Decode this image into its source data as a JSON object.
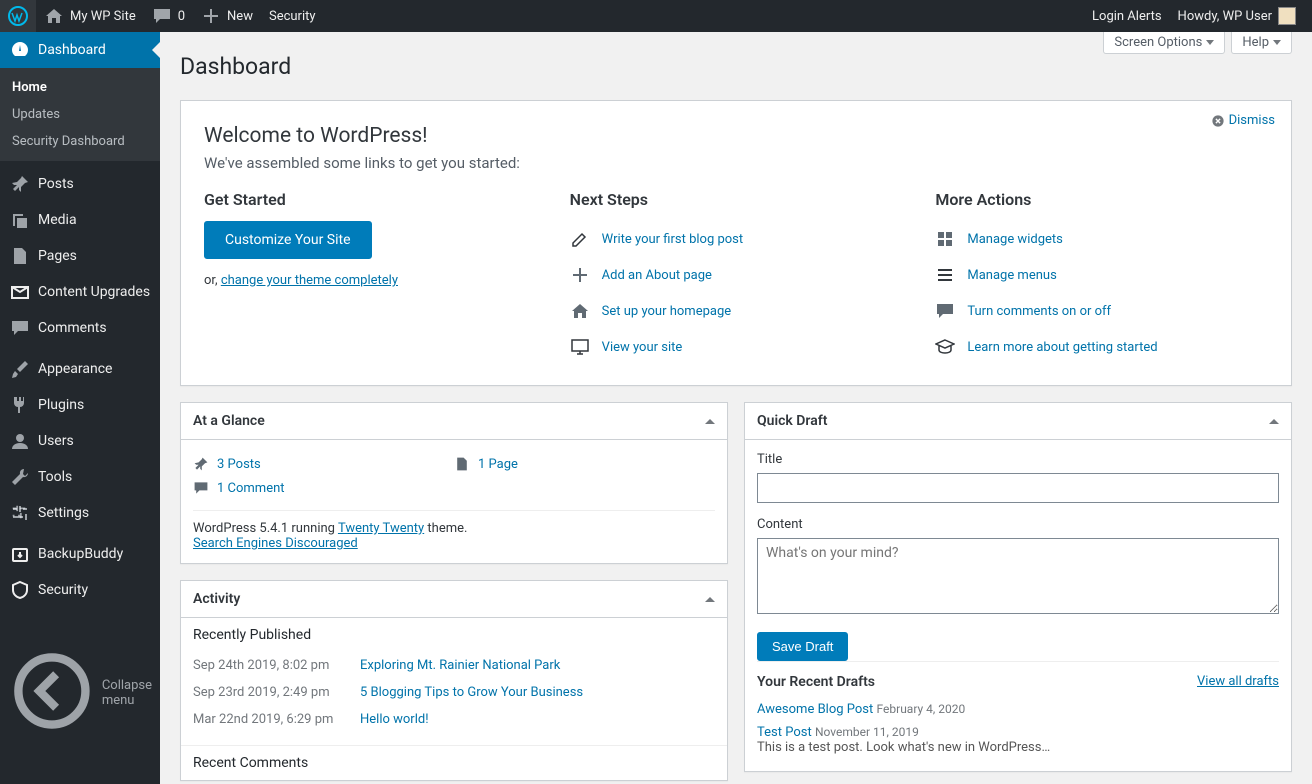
{
  "adminbar": {
    "site_name": "My WP Site",
    "comments": "0",
    "new": "New",
    "security": "Security",
    "login_alerts": "Login Alerts",
    "howdy": "Howdy, WP User"
  },
  "sidebar": {
    "items": [
      {
        "label": "Dashboard",
        "current": true,
        "icon": "dashboard"
      },
      {
        "label": "Posts",
        "icon": "pin"
      },
      {
        "label": "Media",
        "icon": "media"
      },
      {
        "label": "Pages",
        "icon": "pages"
      },
      {
        "label": "Content Upgrades",
        "icon": "mail"
      },
      {
        "label": "Comments",
        "icon": "comment"
      },
      {
        "label": "Appearance",
        "icon": "brush"
      },
      {
        "label": "Plugins",
        "icon": "plug"
      },
      {
        "label": "Users",
        "icon": "user"
      },
      {
        "label": "Tools",
        "icon": "wrench"
      },
      {
        "label": "Settings",
        "icon": "sliders"
      },
      {
        "label": "BackupBuddy",
        "icon": "backup"
      },
      {
        "label": "Security",
        "icon": "shield"
      }
    ],
    "submenu": [
      {
        "label": "Home",
        "current": true
      },
      {
        "label": "Updates"
      },
      {
        "label": "Security Dashboard"
      }
    ],
    "collapse": "Collapse menu"
  },
  "page_title": "Dashboard",
  "screen_options": "Screen Options",
  "help": "Help",
  "welcome": {
    "heading": "Welcome to WordPress!",
    "subtitle": "We've assembled some links to get you started:",
    "dismiss": "Dismiss",
    "get_started": "Get Started",
    "customize_btn": "Customize Your Site",
    "or_text": "or, ",
    "change_theme": "change your theme completely",
    "next_steps": "Next Steps",
    "next_items": [
      "Write your first blog post",
      "Add an About page",
      "Set up your homepage",
      "View your site"
    ],
    "more_actions": "More Actions",
    "more_items": [
      "Manage widgets",
      "Manage menus",
      "Turn comments on or off",
      "Learn more about getting started"
    ]
  },
  "glance": {
    "title": "At a Glance",
    "posts": "3 Posts",
    "page": "1 Page",
    "comment": "1 Comment",
    "running_prefix": "WordPress 5.4.1 running ",
    "theme": "Twenty Twenty",
    "running_suffix": " theme.",
    "discouraged": "Search Engines Discouraged"
  },
  "activity": {
    "title": "Activity",
    "published_heading": "Recently Published",
    "items": [
      {
        "date": "Sep 24th 2019, 8:02 pm",
        "title": "Exploring Mt. Rainier National Park"
      },
      {
        "date": "Sep 23rd 2019, 2:49 pm",
        "title": "5 Blogging Tips to Grow Your Business"
      },
      {
        "date": "Mar 22nd 2019, 6:29 pm",
        "title": "Hello world!"
      }
    ],
    "comments_heading": "Recent Comments"
  },
  "quickdraft": {
    "title": "Quick Draft",
    "title_label": "Title",
    "content_label": "Content",
    "content_placeholder": "What's on your mind?",
    "save": "Save Draft",
    "recent_heading": "Your Recent Drafts",
    "view_all": "View all drafts",
    "drafts": [
      {
        "title": "Awesome Blog Post",
        "date": "February 4, 2020",
        "excerpt": ""
      },
      {
        "title": "Test Post",
        "date": "November 11, 2019",
        "excerpt": "This is a test post. Look what's new in WordPress…"
      }
    ]
  }
}
